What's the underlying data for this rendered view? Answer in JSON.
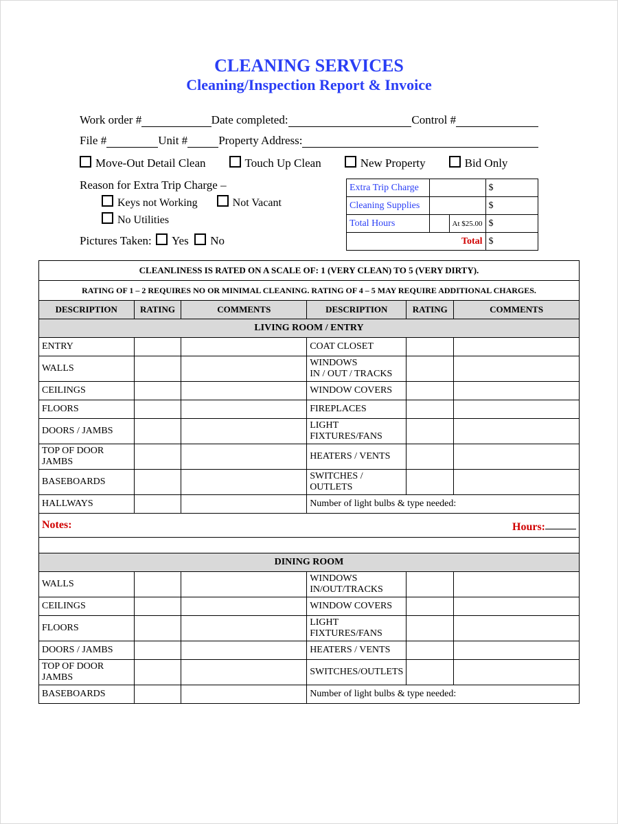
{
  "header": {
    "title": "CLEANING SERVICES",
    "subtitle": "Cleaning/Inspection Report & Invoice"
  },
  "info": {
    "work_order_label": "Work order #",
    "date_completed_label": "Date completed:",
    "control_label": "Control #",
    "file_label": "File #",
    "unit_label": "Unit #",
    "property_label": "Property Address:"
  },
  "clean_types": {
    "move_out": "Move-Out Detail Clean",
    "touch_up": "Touch Up Clean",
    "new_property": "New Property",
    "bid_only": "Bid Only"
  },
  "reason": {
    "label": "Reason for Extra Trip Charge –",
    "keys": "Keys not Working",
    "not_vacant": "Not Vacant",
    "no_utilities": "No Utilities"
  },
  "charges": {
    "extra_trip": "Extra Trip Charge",
    "supplies": "Cleaning Supplies",
    "hours": "Total Hours",
    "rate": "At  $25.00",
    "total": "Total",
    "cur": "$"
  },
  "pictures": {
    "label": "Pictures Taken:",
    "yes": "Yes",
    "no": "No"
  },
  "scale": {
    "line1": "CLEANLINESS IS RATED ON A SCALE OF: 1 (VERY CLEAN) TO 5 (VERY DIRTY).",
    "line2": "RATING OF 1 – 2 REQUIRES NO OR MINIMAL CLEANING.  RATING OF 4 – 5 MAY REQUIRE ADDITIONAL CHARGES."
  },
  "cols": {
    "desc": "DESCRIPTION",
    "rating": "RATING",
    "comments": "COMMENTS"
  },
  "sections": {
    "living_room": {
      "title": "LIVING ROOM / ENTRY",
      "rows": [
        {
          "l": "ENTRY",
          "r": "COAT CLOSET"
        },
        {
          "l": "WALLS",
          "r": "WINDOWS\nIN / OUT / TRACKS"
        },
        {
          "l": "CEILINGS",
          "r": "WINDOW COVERS"
        },
        {
          "l": "FLOORS",
          "r": "FIREPLACES"
        },
        {
          "l": "DOORS / JAMBS",
          "r": "LIGHT FIXTURES/FANS"
        },
        {
          "l": "TOP OF DOOR JAMBS",
          "r": "HEATERS / VENTS"
        },
        {
          "l": "BASEBOARDS",
          "r": "SWITCHES / OUTLETS"
        },
        {
          "l": "HALLWAYS",
          "r": "Number of light bulbs & type needed:"
        }
      ]
    },
    "dining_room": {
      "title": "DINING ROOM",
      "rows": [
        {
          "l": "WALLS",
          "r": "WINDOWS\nIN/OUT/TRACKS"
        },
        {
          "l": "CEILINGS",
          "r": "WINDOW COVERS"
        },
        {
          "l": "FLOORS",
          "r": "LIGHT FIXTURES/FANS"
        },
        {
          "l": "DOORS / JAMBS",
          "r": "HEATERS / VENTS"
        },
        {
          "l": "TOP OF DOOR JAMBS",
          "r": "SWITCHES/OUTLETS"
        },
        {
          "l": "BASEBOARDS",
          "r": "Number of light bulbs & type needed:"
        }
      ]
    }
  },
  "notes": {
    "label": "Notes:",
    "hours": "Hours:"
  }
}
